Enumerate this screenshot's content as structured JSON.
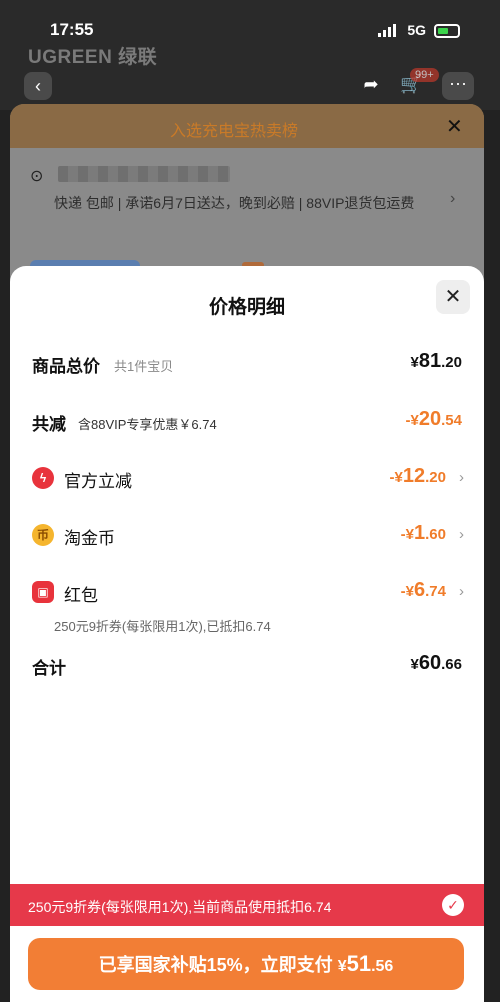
{
  "status": {
    "time": "17:55",
    "network": "5G"
  },
  "background": {
    "brand": "UGREEN 绿联",
    "cart_badge": "99+",
    "hot_list": "入选充电宝热卖榜",
    "shipping": "快递 包邮 | 承诺6月7日送达，晚到必赔 | 88VIP退货包运费"
  },
  "sheet": {
    "title": "价格明细",
    "total": {
      "label": "商品总价",
      "sub": "共1件宝贝",
      "yen": "¥",
      "int": "81",
      "dec": ".20"
    },
    "reduce": {
      "label": "共减",
      "sub": "含88VIP专享优惠￥6.74",
      "yen": "-¥",
      "int": "20",
      "dec": ".54"
    },
    "items": [
      {
        "label": "官方立减",
        "yen": "-¥",
        "int": "12",
        "dec": ".20"
      },
      {
        "label": "淘金币",
        "yen": "-¥",
        "int": "1",
        "dec": ".60"
      },
      {
        "label": "红包",
        "yen": "-¥",
        "int": "6",
        "dec": ".74"
      }
    ],
    "coupon_note": "250元9折券(每张限用1次),已抵扣6.74",
    "sum": {
      "label": "合计",
      "yen": "¥",
      "int": "60",
      "dec": ".66"
    }
  },
  "banner": {
    "text": "250元9折券(每张限用1次),当前商品使用抵扣6.74"
  },
  "pay": {
    "prefix": "已享国家补贴15%，立即支付 ",
    "yen": "¥",
    "int": "51",
    "dec": ".56"
  },
  "colors": {
    "accent_orange": "#f07c2a",
    "banner_red": "#e6394a",
    "pay_orange": "#f27e35"
  }
}
